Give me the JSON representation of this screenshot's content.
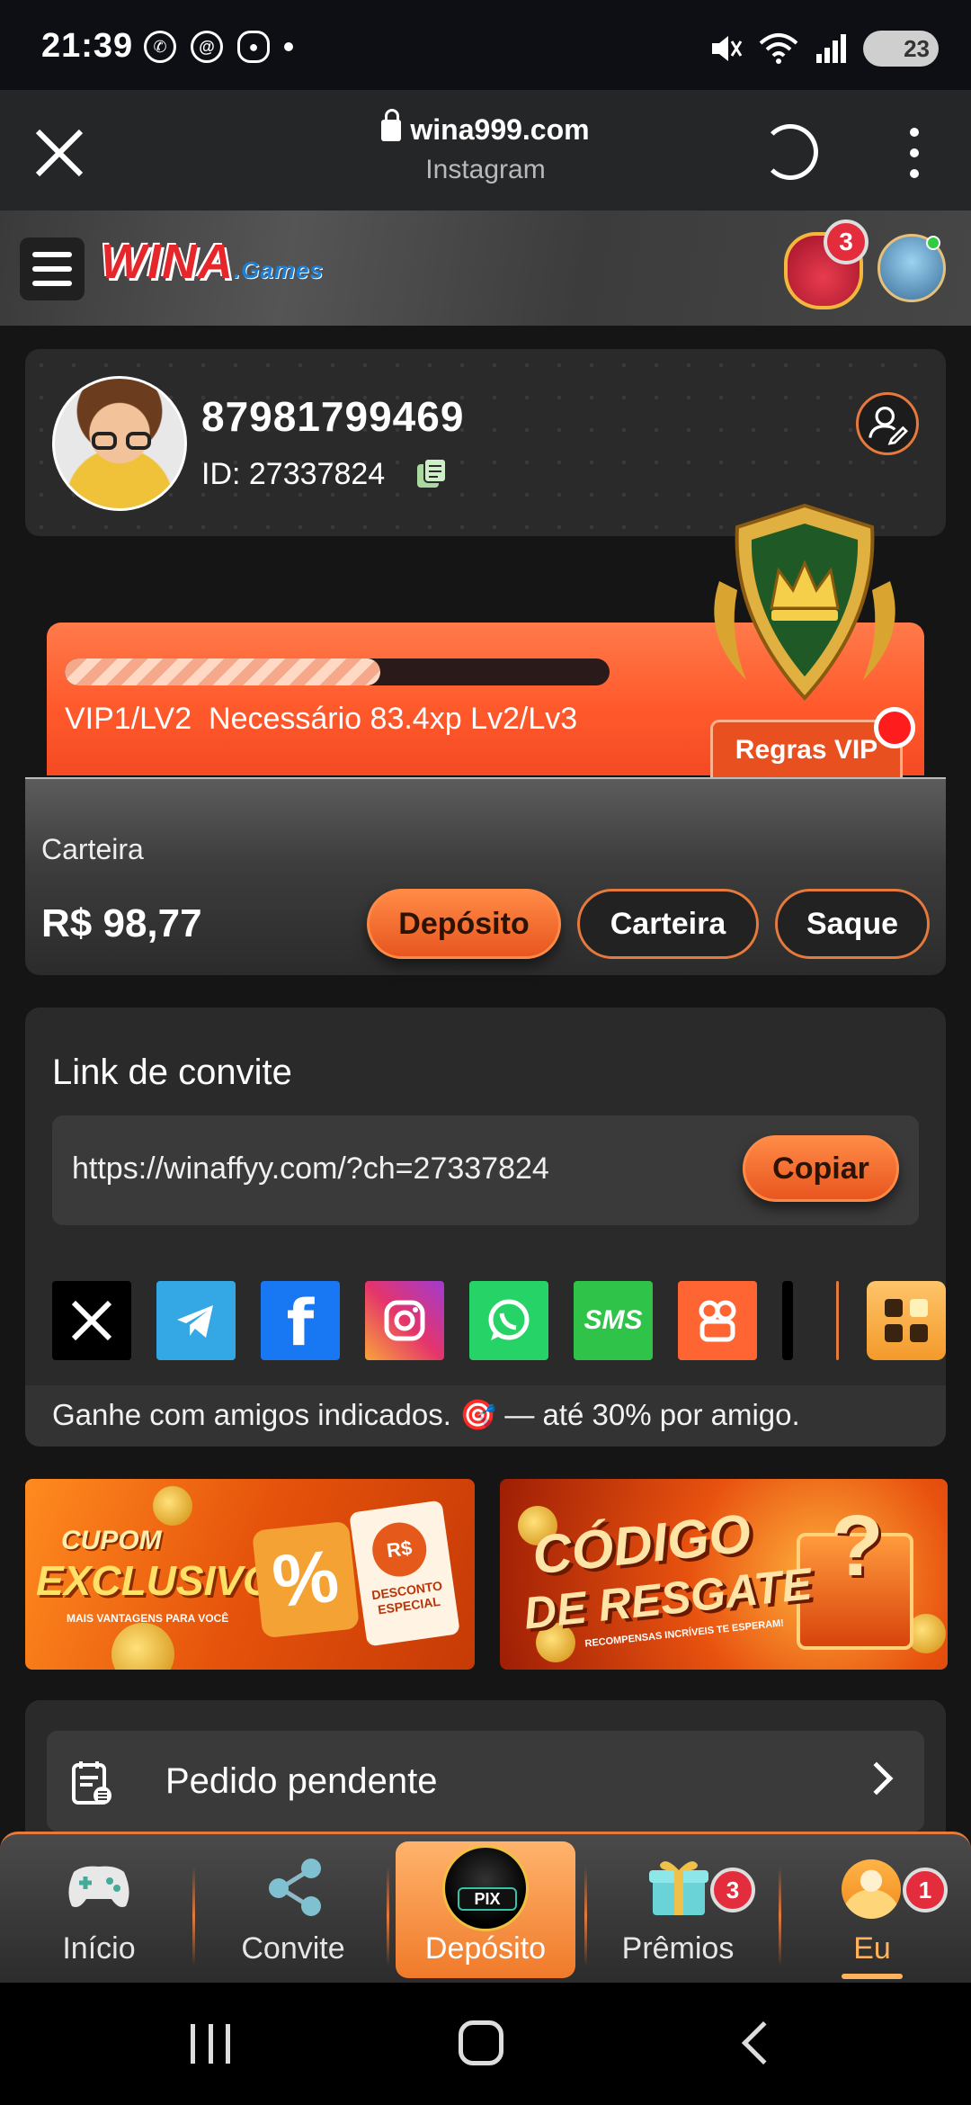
{
  "status_bar": {
    "time": "21:39",
    "battery": "23",
    "notification_icons": [
      "whatsapp-icon",
      "threads-icon",
      "app-icon"
    ],
    "system_icons": [
      "mute-icon",
      "wifi-icon",
      "signal-icon"
    ]
  },
  "browser": {
    "url": "wina999.com",
    "source": "Instagram"
  },
  "header": {
    "logo_main": "WINA",
    "logo_suffix": ".Games",
    "gift_badge": "3"
  },
  "profile": {
    "username": "87981799469",
    "id_label": "ID: 27337824"
  },
  "vip": {
    "progress": 0.58,
    "level_text": "VIP1/LV2  Necessário 83.4xp Lv2/Lv3",
    "rules_button": "Regras VIP"
  },
  "wallet": {
    "label": "Carteira",
    "balance": "R$ 98,77",
    "deposit_button": "Depósito",
    "wallet_button": "Carteira",
    "withdraw_button": "Saque"
  },
  "invite": {
    "title": "Link de convite",
    "link": "https://winaffyy.com/?ch=27337824",
    "copy_button": "Copiar",
    "sms_label": "SMS",
    "footer_text": "Ganhe com amigos indicados. 🎯 — até 30% por amigo.",
    "share_icons": [
      "x-icon",
      "telegram-icon",
      "facebook-icon",
      "instagram-icon",
      "whatsapp-icon",
      "sms-icon",
      "kwai-icon",
      "more-apps-icon"
    ]
  },
  "banners": {
    "coupon": {
      "line1": "CUPOM",
      "line2": "EXCLUSIVO",
      "line3": "MAIS VANTAGENS PARA VOCÊ",
      "percent": "%",
      "ticket_currency": "R$",
      "ticket_text": "DESCONTO ESPECIAL"
    },
    "redeem": {
      "line1": "CÓDIGO",
      "line2": "DE RESGATE",
      "line3": "RECOMPENSAS INCRÍVEIS TE ESPERAM!",
      "mark": "?"
    }
  },
  "pending": {
    "label": "Pedido pendente"
  },
  "bottom_nav": {
    "items": [
      {
        "label": "Início",
        "icon": "gamepad-icon"
      },
      {
        "label": "Convite",
        "icon": "share-icon"
      },
      {
        "label": "Depósito",
        "icon": "pix-icon",
        "sub": "PIX"
      },
      {
        "label": "Prêmios",
        "icon": "gift-icon",
        "badge": "3"
      },
      {
        "label": "Eu",
        "icon": "user-icon",
        "badge": "1"
      }
    ],
    "active": "Depósito",
    "colors": {
      "accent": "#e67a3c",
      "active_label": "#ffb35c"
    }
  }
}
